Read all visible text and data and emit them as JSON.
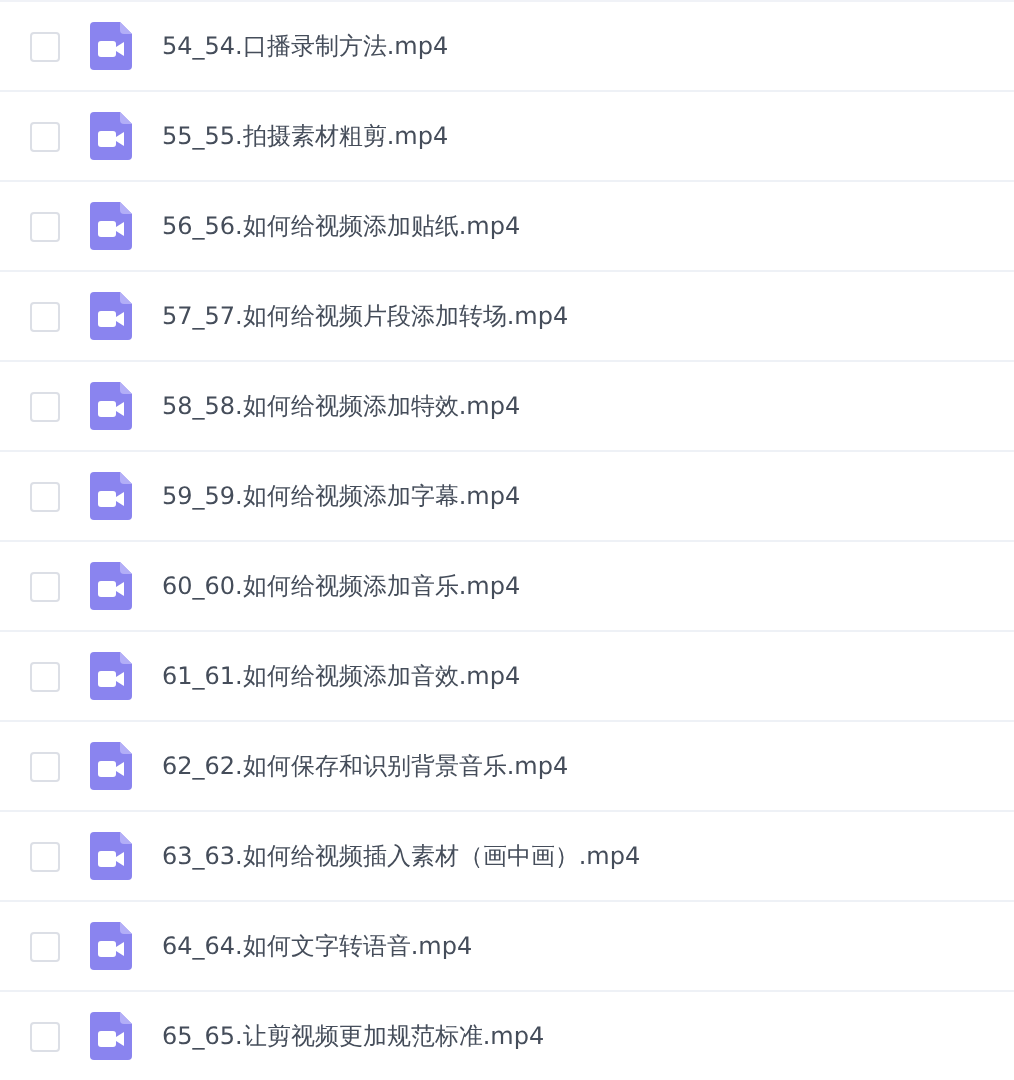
{
  "files": [
    {
      "name": "54_54.口播录制方法.mp4",
      "checked": false
    },
    {
      "name": "55_55.拍摄素材粗剪.mp4",
      "checked": false
    },
    {
      "name": "56_56.如何给视频添加贴纸.mp4",
      "checked": false
    },
    {
      "name": "57_57.如何给视频片段添加转场.mp4",
      "checked": false
    },
    {
      "name": "58_58.如何给视频添加特效.mp4",
      "checked": false
    },
    {
      "name": "59_59.如何给视频添加字幕.mp4",
      "checked": false
    },
    {
      "name": "60_60.如何给视频添加音乐.mp4",
      "checked": false
    },
    {
      "name": "61_61.如何给视频添加音效.mp4",
      "checked": false
    },
    {
      "name": "62_62.如何保存和识别背景音乐.mp4",
      "checked": false
    },
    {
      "name": "63_63.如何给视频插入素材（画中画）.mp4",
      "checked": false
    },
    {
      "name": "64_64.如何文字转语音.mp4",
      "checked": false
    },
    {
      "name": "65_65.让剪视频更加规范标准.mp4",
      "checked": false
    }
  ]
}
